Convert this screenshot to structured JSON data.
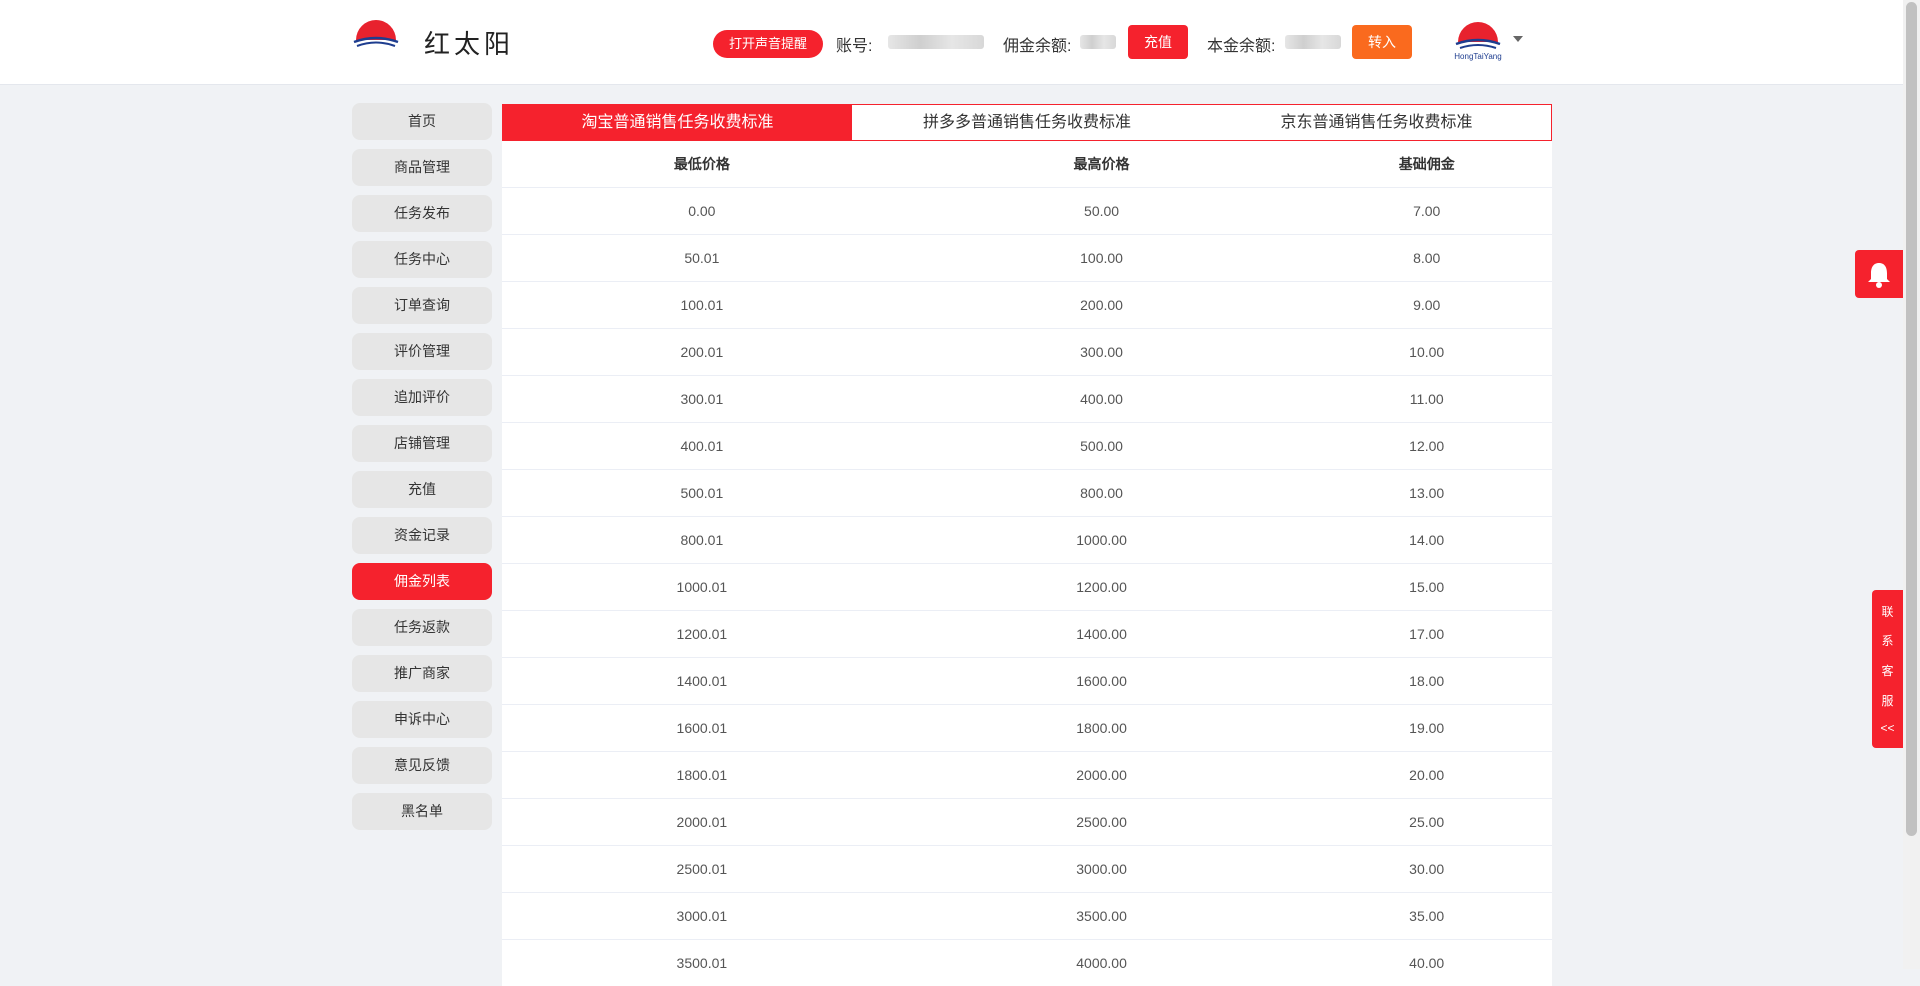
{
  "header": {
    "brand": "红太阳",
    "logo_text": "HongTaiYang",
    "sound_button": "打开声音提醒",
    "account_label": "账号:",
    "commission_label": "佣金余额:",
    "recharge_button": "充值",
    "principal_label": "本金余额:",
    "transfer_button": "转入"
  },
  "sidebar": {
    "items": [
      {
        "label": "首页"
      },
      {
        "label": "商品管理"
      },
      {
        "label": "任务发布"
      },
      {
        "label": "任务中心"
      },
      {
        "label": "订单查询"
      },
      {
        "label": "评价管理"
      },
      {
        "label": "追加评价"
      },
      {
        "label": "店铺管理"
      },
      {
        "label": "充值"
      },
      {
        "label": "资金记录"
      },
      {
        "label": "佣金列表"
      },
      {
        "label": "任务返款"
      },
      {
        "label": "推广商家"
      },
      {
        "label": "申诉中心"
      },
      {
        "label": "意见反馈"
      },
      {
        "label": "黑名单"
      }
    ],
    "active": "佣金列表"
  },
  "tabs": [
    {
      "label": "淘宝普通销售任务收费标准"
    },
    {
      "label": "拼多多普通销售任务收费标准"
    },
    {
      "label": "京东普通销售任务收费标准"
    }
  ],
  "table": {
    "headers": [
      "最低价格",
      "最高价格",
      "基础佣金"
    ],
    "rows": [
      [
        "0.00",
        "50.00",
        "7.00"
      ],
      [
        "50.01",
        "100.00",
        "8.00"
      ],
      [
        "100.01",
        "200.00",
        "9.00"
      ],
      [
        "200.01",
        "300.00",
        "10.00"
      ],
      [
        "300.01",
        "400.00",
        "11.00"
      ],
      [
        "400.01",
        "500.00",
        "12.00"
      ],
      [
        "500.01",
        "800.00",
        "13.00"
      ],
      [
        "800.01",
        "1000.00",
        "14.00"
      ],
      [
        "1000.01",
        "1200.00",
        "15.00"
      ],
      [
        "1200.01",
        "1400.00",
        "17.00"
      ],
      [
        "1400.01",
        "1600.00",
        "18.00"
      ],
      [
        "1600.01",
        "1800.00",
        "19.00"
      ],
      [
        "1800.01",
        "2000.00",
        "20.00"
      ],
      [
        "2000.01",
        "2500.00",
        "25.00"
      ],
      [
        "2500.01",
        "3000.00",
        "30.00"
      ],
      [
        "3000.01",
        "3500.00",
        "35.00"
      ],
      [
        "3500.01",
        "4000.00",
        "40.00"
      ]
    ]
  },
  "customer_service": [
    "联",
    "系",
    "客",
    "服",
    "<<"
  ],
  "colors": {
    "primary": "#f5222d",
    "orange": "#fa6a1e"
  },
  "icons": {
    "bell": "bell-icon"
  }
}
